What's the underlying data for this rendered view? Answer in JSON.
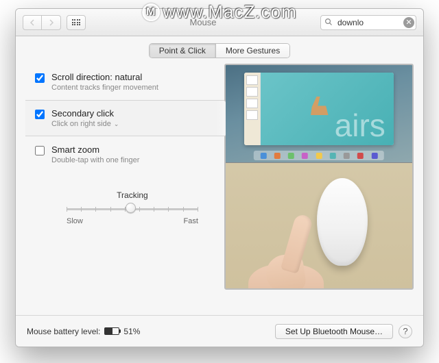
{
  "watermark": "www.MacZ.com",
  "window_title": "Mouse",
  "search": {
    "value": "downlo"
  },
  "tabs": {
    "point_click": "Point & Click",
    "more_gestures": "More Gestures"
  },
  "options": {
    "scroll": {
      "title": "Scroll direction: natural",
      "sub": "Content tracks finger movement",
      "checked": true
    },
    "secondary": {
      "title": "Secondary click",
      "sub": "Click on right side",
      "checked": true
    },
    "zoom": {
      "title": "Smart zoom",
      "sub": "Double-tap with one finger",
      "checked": false
    }
  },
  "tracking": {
    "label": "Tracking",
    "slow": "Slow",
    "fast": "Fast"
  },
  "preview": {
    "big_text": "airs"
  },
  "footer": {
    "batt_label": "Mouse battery level:",
    "batt_pct": "51%",
    "setup": "Set Up Bluetooth Mouse…"
  }
}
